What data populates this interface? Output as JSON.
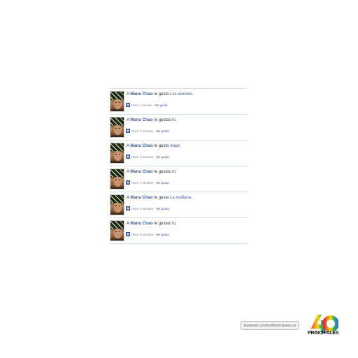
{
  "feed": {
    "stories": [
      {
        "prefix": "A",
        "who": "Manu Chao",
        "verb": "le gusta",
        "what": "Los aviones.",
        "time": "Hace 1 minuto",
        "sep": " · ",
        "like": "Me gusta"
      },
      {
        "prefix": "A",
        "who": "Manu Chao",
        "verb": "le gustas",
        "what": "tú.",
        "time": "Hace 2 minutos",
        "sep": " · ",
        "like": "Me gusta"
      },
      {
        "prefix": "A",
        "who": "Manu Chao",
        "verb": "le gusta",
        "what": "viajar.",
        "time": "Hace 3 minutos",
        "sep": " · ",
        "like": "Me gusta"
      },
      {
        "prefix": "A",
        "who": "Manu Chao",
        "verb": "le gustas",
        "what": "tú.",
        "time": "Hace 4 minutos",
        "sep": " · ",
        "like": "Me gusta"
      },
      {
        "prefix": "A",
        "who": "Manu Chao",
        "verb": "le gusta",
        "what": "La mañana.",
        "time": "Hace 5 minutos",
        "sep": " · ",
        "like": "Me gusta"
      },
      {
        "prefix": "A",
        "who": "Manu Chao",
        "verb": "le gustas",
        "what": "tú.",
        "time": "Hace 6 minutos",
        "sep": " · ",
        "like": "Me gusta"
      }
    ]
  },
  "footer": {
    "url": "facebook.com/los40principales.es",
    "logo_text": "PRINCIPALES"
  },
  "colors": {
    "link": "#3b5998",
    "divider": "#d9dde6"
  },
  "icons": {
    "avatar": "profile-photo",
    "like": "thumbs-up-icon",
    "logo": "los40-logo"
  }
}
